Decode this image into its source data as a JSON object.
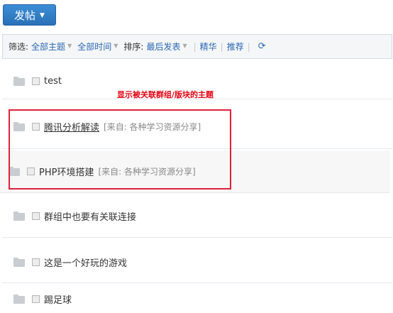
{
  "toolbar": {
    "post_label": "发帖"
  },
  "filter": {
    "filter_label": "筛选:",
    "topic_option": "全部主题",
    "time_option": "全部时间",
    "sort_label": "排序:",
    "sort_option": "最后发表",
    "elite_link": "精华",
    "recommend_link": "推荐",
    "refresh_icon": "refresh-icon"
  },
  "annotation": {
    "text": "显示被关联群组/版块的主题",
    "color": "#e60012"
  },
  "threads": [
    {
      "title": "test",
      "source": ""
    },
    {
      "title": "腾讯分析解读",
      "source": "[来自: 各种学习资源分享]"
    },
    {
      "title": "PHP环境搭建",
      "source": "[来自: 各种学习资源分享]"
    },
    {
      "title": "群组中也要有关联连接",
      "source": ""
    },
    {
      "title": "这是一个好玩的游戏",
      "source": ""
    },
    {
      "title": "踢足球",
      "source": ""
    }
  ]
}
